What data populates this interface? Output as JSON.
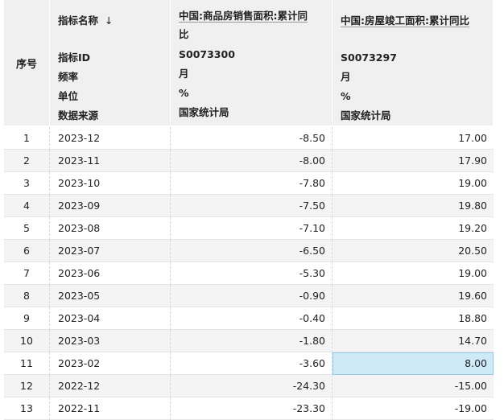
{
  "header": {
    "index_label": "序号",
    "meta_col": {
      "title": "指标名称",
      "sort_icon": "↓",
      "lines": [
        "指标ID",
        "频率",
        "单位",
        "数据来源"
      ]
    },
    "series": [
      {
        "title_line1": "中国:商品房销售面积:累计同",
        "title_line2": "比",
        "id": "S0073300",
        "frequency": "月",
        "unit": "%",
        "source": "国家统计局"
      },
      {
        "title_line1": "中国:房屋竣工面积:累计同比",
        "title_line2": "",
        "id": "S0073297",
        "frequency": "月",
        "unit": "%",
        "source": "国家统计局"
      }
    ]
  },
  "rows": [
    {
      "idx": "1",
      "date": "2023-12",
      "a": "-8.50",
      "b": "17.00"
    },
    {
      "idx": "2",
      "date": "2023-11",
      "a": "-8.00",
      "b": "17.90"
    },
    {
      "idx": "3",
      "date": "2023-10",
      "a": "-7.80",
      "b": "19.00"
    },
    {
      "idx": "4",
      "date": "2023-09",
      "a": "-7.50",
      "b": "19.80"
    },
    {
      "idx": "5",
      "date": "2023-08",
      "a": "-7.10",
      "b": "19.20"
    },
    {
      "idx": "6",
      "date": "2023-07",
      "a": "-6.50",
      "b": "20.50"
    },
    {
      "idx": "7",
      "date": "2023-06",
      "a": "-5.30",
      "b": "19.00"
    },
    {
      "idx": "8",
      "date": "2023-05",
      "a": "-0.90",
      "b": "19.60"
    },
    {
      "idx": "9",
      "date": "2023-04",
      "a": "-0.40",
      "b": "18.80"
    },
    {
      "idx": "10",
      "date": "2023-03",
      "a": "-1.80",
      "b": "14.70"
    },
    {
      "idx": "11",
      "date": "2023-02",
      "a": "-3.60",
      "b": "8.00"
    },
    {
      "idx": "12",
      "date": "2022-12",
      "a": "-24.30",
      "b": "-15.00"
    },
    {
      "idx": "13",
      "date": "2022-11",
      "a": "-23.30",
      "b": "-19.00"
    }
  ],
  "selected_cell": {
    "row": 10,
    "column": "b"
  },
  "colors": {
    "header_bg": "#f0f0f0",
    "row_alt_bg": "#f4f4f4",
    "selection_bg": "#cfeaf7"
  }
}
